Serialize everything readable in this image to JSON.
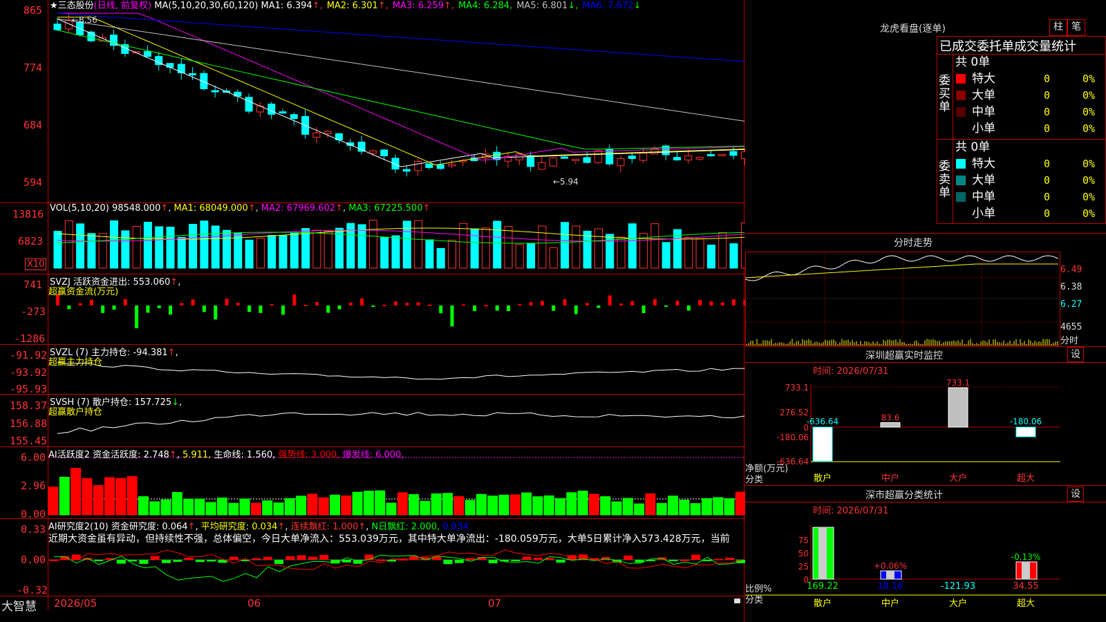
{
  "app": {
    "logo": "大智慧"
  },
  "chart": {
    "title_star": "★",
    "stock_name": "三态股份",
    "period_label": "(日线, 前复权)",
    "ma_label": "MA(5,10,20,30,60,120)",
    "ma_values": [
      {
        "text": "MA1: 6.394",
        "arrow": "↑",
        "color": "#ffffff"
      },
      {
        "text": "MA2: 6.301",
        "arrow": "↑",
        "color": "#ffff00"
      },
      {
        "text": "MA3: 6.259",
        "arrow": "↑",
        "color": "#ff00ff"
      },
      {
        "text": "MA4: 6.284,",
        "arrow": "",
        "color": "#00ff00"
      },
      {
        "text": "MA5: 6.801",
        "arrow": "↓",
        "color": "#c0c0c0"
      },
      {
        "text": "MA6: 7.672",
        "arrow": "↓",
        "color": "#0000ff"
      }
    ],
    "price_axis": [
      "865",
      "774",
      "684",
      "594"
    ],
    "high_marker": "8.56",
    "low_marker": "←5.94"
  },
  "vol": {
    "label": "VOL(5,10,20)",
    "value": "98548.000",
    "ma1": "MA1: 68049.000",
    "ma2": "MA2: 67969.602",
    "ma3": "MA3: 67225.500",
    "axis": [
      "13816",
      "6823"
    ],
    "unit": "X10"
  },
  "svzj": {
    "label": "SVZJ  活跃资金进出: 553.060",
    "sub": "超赢资金流(万元)",
    "axis": [
      "741",
      "-273",
      "-1286"
    ]
  },
  "svzl": {
    "label": "SVZL (7) 主力持仓: -94.381",
    "sub": "超赢主力持仓",
    "axis": [
      "-91.92",
      "-93.92",
      "-95.93"
    ]
  },
  "svsh": {
    "label": "SVSH (7) 散户持仓: 157.725",
    "sub": "超赢散户持仓",
    "axis": [
      "158.37",
      "156.88",
      "155.45"
    ]
  },
  "ai1": {
    "label": "AI活跃度2 资金活跃度: 2.748",
    "v2": "5.911,",
    "v3": "生命线: 1.560,",
    "v4": "强势线: 3.000,",
    "v5": "爆发线: 6.000,",
    "axis": [
      "6.00",
      "2.96",
      "0.00"
    ]
  },
  "ai2": {
    "label": "AI研究度2(10) 资金研究度: 0.064",
    "v2": "平均研究度: 0.034",
    "v3": "连续飘红: 1.000",
    "v4": "N日飘红: 2.000,",
    "v5": "0.034",
    "comment": "近期大资金虽有异动，但持续性不强，总体偏空，今日大单净流入：553.039万元，其中特大单净流出：-180.059万元，大单5日累计净入573.428万元，当前",
    "axis": [
      "0.33",
      "0.00",
      "-0.32"
    ]
  },
  "timeline": {
    "labels": [
      "2026/05",
      "06",
      "07"
    ]
  },
  "longhu": {
    "title": "龙虎看盘(逐单)",
    "btn_bar": "柱",
    "btn_pen": "笔",
    "subtitle": "已成交委托单成交量统计",
    "buy": {
      "side": "委买单",
      "total": "共 0单",
      "rows": [
        {
          "name": "特大",
          "count": "0",
          "pct": "0%",
          "color": "#ff0000"
        },
        {
          "name": "大单",
          "count": "0",
          "pct": "0%",
          "color": "#880000"
        },
        {
          "name": "中单",
          "count": "0",
          "pct": "0%",
          "color": "#550000"
        },
        {
          "name": "小单",
          "count": "0",
          "pct": "0%",
          "color": ""
        }
      ]
    },
    "sell": {
      "side": "委卖单",
      "total": "共 0单",
      "rows": [
        {
          "name": "特大",
          "count": "0",
          "pct": "0%",
          "color": "#00ffff"
        },
        {
          "name": "大单",
          "count": "0",
          "pct": "0%",
          "color": "#008888"
        },
        {
          "name": "中单",
          "count": "0",
          "pct": "0%",
          "color": "#006666"
        },
        {
          "name": "小单",
          "count": "0",
          "pct": "0%",
          "color": ""
        }
      ]
    }
  },
  "intraday": {
    "title": "分时走势",
    "axis": [
      "6.49",
      "6.38",
      "6.27",
      "4655"
    ],
    "unit": "分时"
  },
  "monitor": {
    "title": "深圳超赢实时监控",
    "btn": "设",
    "time": "时间: 2026/07/31",
    "axis": [
      "733.1",
      "276.52",
      "0",
      "-180.06",
      "-636.64"
    ],
    "ylabel1": "净额(万元)",
    "ylabel2": "分类",
    "categories": [
      "散户",
      "中户",
      "大户",
      "超大"
    ],
    "values": [
      -636.64,
      83.6,
      733.1,
      -180.06
    ],
    "labels": [
      "-636.64",
      "83.6",
      "733.1",
      "-180.06"
    ]
  },
  "classify": {
    "title": "深市超赢分类统计",
    "btn": "设",
    "time": "时间: 2026/07/31",
    "axis": [
      "75",
      "50",
      "25",
      "0"
    ],
    "ylabel1": "比例%",
    "ylabel2": "分类",
    "categories": [
      "散户",
      "中户",
      "大户",
      "超大"
    ],
    "pct_labels": [
      "",
      "+0.06%",
      "",
      "-0.13%"
    ],
    "values": [
      "169.22",
      "18.16",
      "-121.93",
      "34.55"
    ]
  }
}
